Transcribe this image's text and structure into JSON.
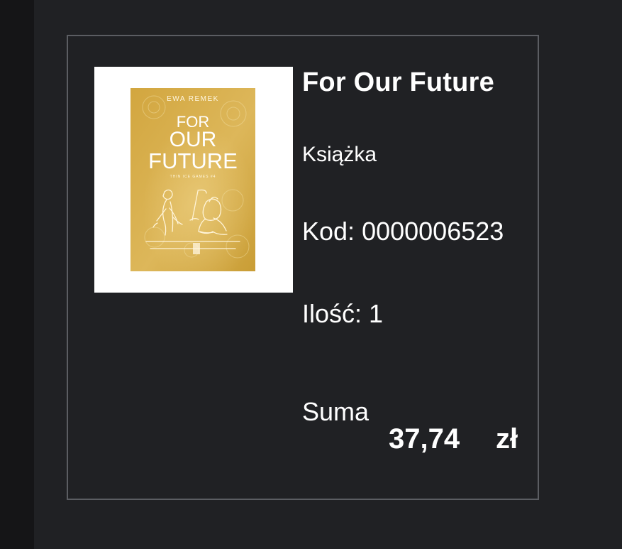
{
  "product": {
    "title": "For Our Future",
    "type": "Książka",
    "code_label": "Kod:",
    "code_value": "0000006523",
    "qty_label": "Ilość:",
    "qty_value": "1",
    "sum_label": "Suma",
    "sum_value": "37,74",
    "currency": "zł",
    "cover": {
      "author": "EWA REMEK",
      "title_line1": "FOR",
      "title_line2": "OUR",
      "title_line3": "FUTURE",
      "series": "THIN ICE GAMES #4",
      "background": "#d8b24c",
      "accent": "#fff4d8"
    }
  }
}
